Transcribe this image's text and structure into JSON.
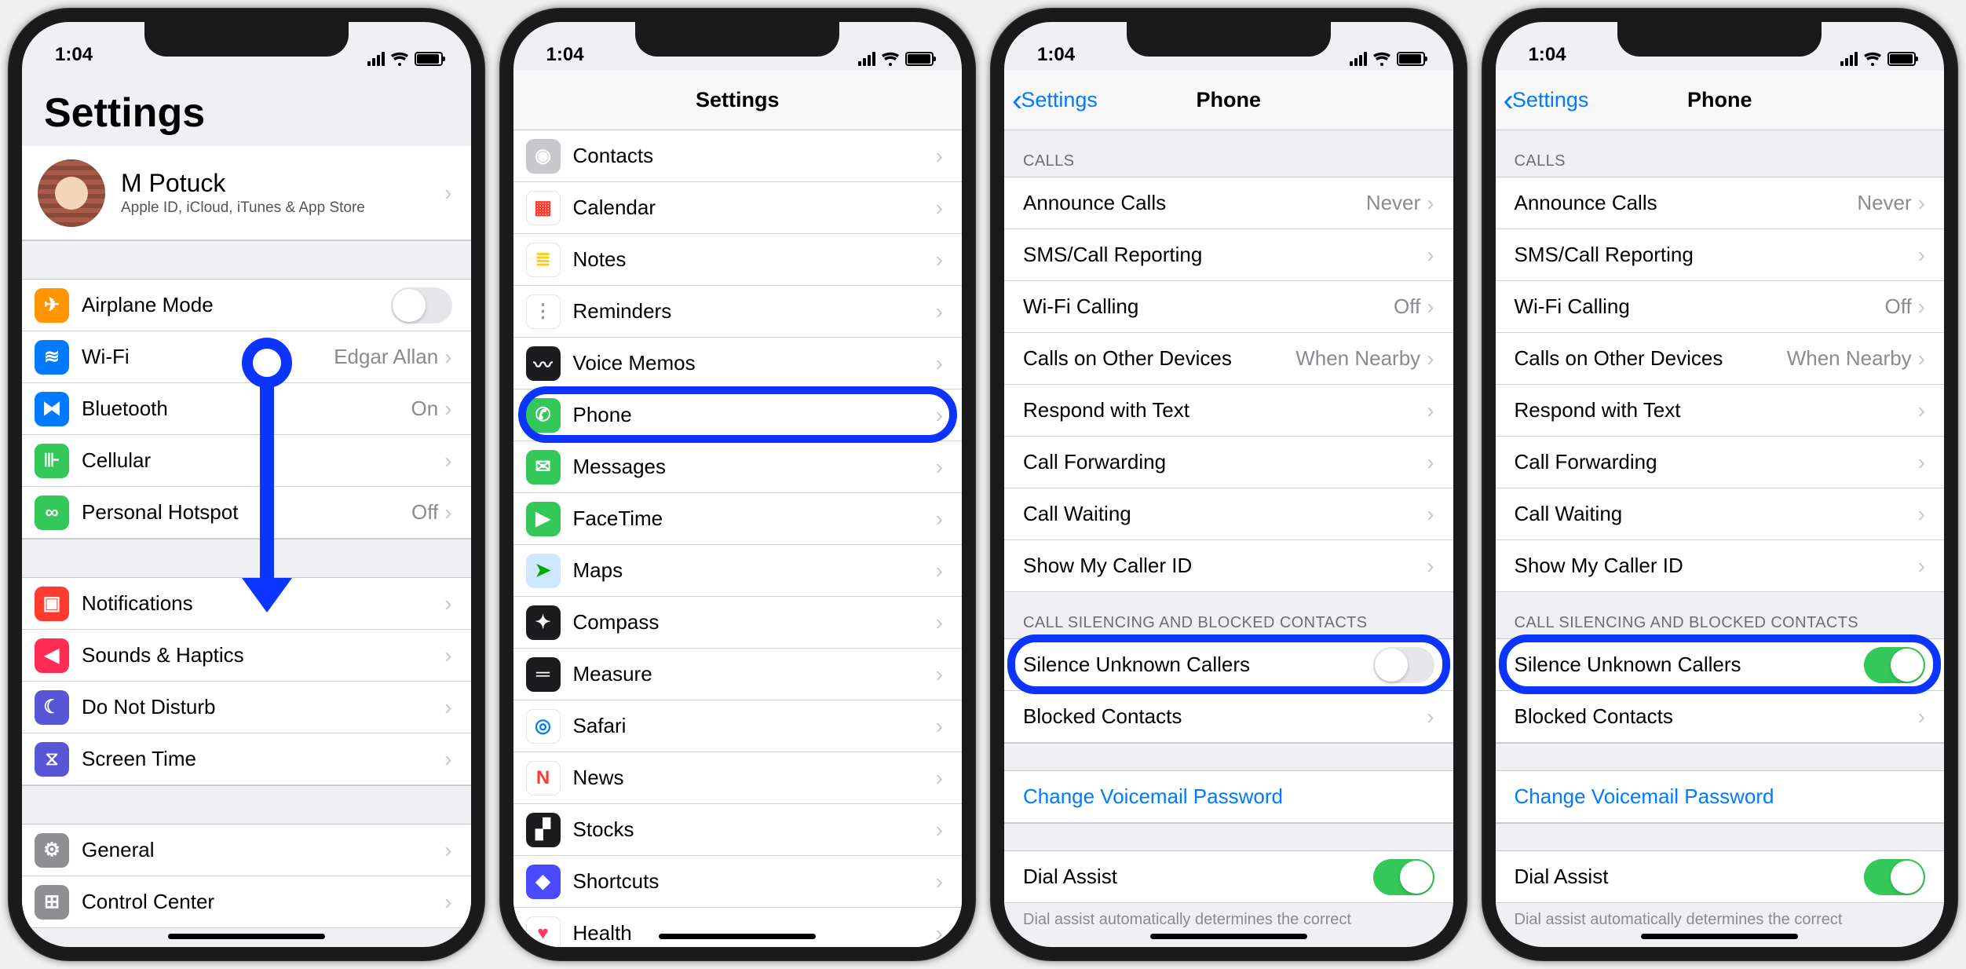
{
  "status": {
    "time": "1:04"
  },
  "p1": {
    "title": "Settings",
    "profile": {
      "name": "M Potuck",
      "sub": "Apple ID, iCloud, iTunes & App Store"
    },
    "rows1": [
      {
        "label": "Airplane Mode",
        "iconBg": "#ff9500",
        "glyph": "✈",
        "toggle": false
      },
      {
        "label": "Wi-Fi",
        "iconBg": "#007aff",
        "glyph": "≋",
        "value": "Edgar Allan"
      },
      {
        "label": "Bluetooth",
        "iconBg": "#007aff",
        "glyph": "⧓",
        "value": "On"
      },
      {
        "label": "Cellular",
        "iconBg": "#34c759",
        "glyph": "⊪"
      },
      {
        "label": "Personal Hotspot",
        "iconBg": "#34c759",
        "glyph": "∞",
        "value": "Off"
      }
    ],
    "rows2": [
      {
        "label": "Notifications",
        "iconBg": "#ff3b30",
        "glyph": "▣"
      },
      {
        "label": "Sounds & Haptics",
        "iconBg": "#ff2d55",
        "glyph": "◀"
      },
      {
        "label": "Do Not Disturb",
        "iconBg": "#5856d6",
        "glyph": "☾"
      },
      {
        "label": "Screen Time",
        "iconBg": "#5856d6",
        "glyph": "⧖"
      }
    ],
    "rows3": [
      {
        "label": "General",
        "iconBg": "#8e8e93",
        "glyph": "⚙"
      },
      {
        "label": "Control Center",
        "iconBg": "#8e8e93",
        "glyph": "⊞"
      }
    ]
  },
  "p2": {
    "title": "Settings",
    "rows": [
      {
        "label": "Contacts",
        "iconBg": "#c7c7cc",
        "glyph": "◉"
      },
      {
        "label": "Calendar",
        "iconBg": "#ffffff",
        "glyph": "▦",
        "glyphColor": "#ff3b30"
      },
      {
        "label": "Notes",
        "iconBg": "#ffffff",
        "glyph": "≣",
        "glyphColor": "#fc0"
      },
      {
        "label": "Reminders",
        "iconBg": "#ffffff",
        "glyph": "⋮",
        "glyphColor": "#999"
      },
      {
        "label": "Voice Memos",
        "iconBg": "#1c1c1e",
        "glyph": "〰"
      },
      {
        "label": "Phone",
        "iconBg": "#34c759",
        "glyph": "✆",
        "highlight": true
      },
      {
        "label": "Messages",
        "iconBg": "#34c759",
        "glyph": "✉"
      },
      {
        "label": "FaceTime",
        "iconBg": "#34c759",
        "glyph": "▶"
      },
      {
        "label": "Maps",
        "iconBg": "#d0e8ff",
        "glyph": "➤",
        "glyphColor": "#0a0"
      },
      {
        "label": "Compass",
        "iconBg": "#1c1c1e",
        "glyph": "✦"
      },
      {
        "label": "Measure",
        "iconBg": "#1c1c1e",
        "glyph": "═"
      },
      {
        "label": "Safari",
        "iconBg": "#ffffff",
        "glyph": "◎",
        "glyphColor": "#007aff"
      },
      {
        "label": "News",
        "iconBg": "#ffffff",
        "glyph": "N",
        "glyphColor": "#ff3b30"
      },
      {
        "label": "Stocks",
        "iconBg": "#1c1c1e",
        "glyph": "▞"
      },
      {
        "label": "Shortcuts",
        "iconBg": "#4a4aff",
        "glyph": "◆"
      },
      {
        "label": "Health",
        "iconBg": "#ffffff",
        "glyph": "♥",
        "glyphColor": "#ff3b5c"
      }
    ]
  },
  "phone_page": {
    "back": "Settings",
    "title": "Phone",
    "callsHeader": "CALLS",
    "calls": [
      {
        "label": "Announce Calls",
        "value": "Never"
      },
      {
        "label": "SMS/Call Reporting"
      },
      {
        "label": "Wi-Fi Calling",
        "value": "Off"
      },
      {
        "label": "Calls on Other Devices",
        "value": "When Nearby"
      },
      {
        "label": "Respond with Text"
      },
      {
        "label": "Call Forwarding"
      },
      {
        "label": "Call Waiting"
      },
      {
        "label": "Show My Caller ID"
      }
    ],
    "silenceHeader": "CALL SILENCING AND BLOCKED CONTACTS",
    "silenceLabel": "Silence Unknown Callers",
    "blockedLabel": "Blocked Contacts",
    "voicemail": "Change Voicemail Password",
    "dialAssist": "Dial Assist",
    "dialFooter": "Dial assist automatically determines the correct"
  },
  "p3": {
    "silenceOn": false
  },
  "p4": {
    "silenceOn": true
  }
}
